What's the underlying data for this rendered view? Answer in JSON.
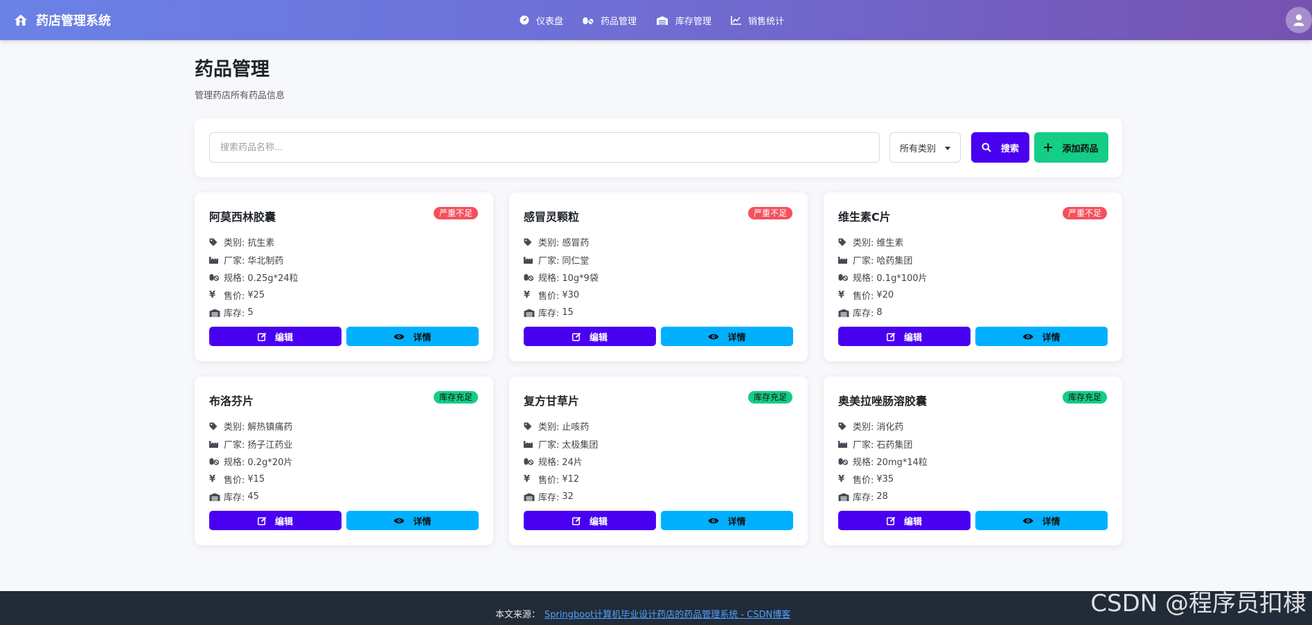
{
  "navbar": {
    "brand": "药店管理系统",
    "items": [
      {
        "label": "仪表盘",
        "icon": "dashboard-icon"
      },
      {
        "label": "药品管理",
        "icon": "pills-icon"
      },
      {
        "label": "库存管理",
        "icon": "warehouse-icon"
      },
      {
        "label": "销售统计",
        "icon": "chart-line-icon"
      }
    ]
  },
  "page": {
    "title": "药品管理",
    "subtitle": "管理药店所有药品信息"
  },
  "search": {
    "placeholder": "搜索药品名称...",
    "category_selected": "所有类别",
    "search_label": "搜索",
    "add_label": "添加药品"
  },
  "labels": {
    "category": "类别:",
    "maker": "厂家:",
    "spec": "规格:",
    "price": "售价:",
    "stock": "库存:",
    "edit": "编辑",
    "detail": "详情"
  },
  "medicines": [
    {
      "name": "阿莫西林胶囊",
      "status": "严重不足",
      "status_type": "low",
      "category": "抗生素",
      "maker": "华北制药",
      "spec": "0.25g*24粒",
      "price": "¥25",
      "stock": "5"
    },
    {
      "name": "感冒灵颗粒",
      "status": "严重不足",
      "status_type": "low",
      "category": "感冒药",
      "maker": "同仁堂",
      "spec": "10g*9袋",
      "price": "¥30",
      "stock": "15"
    },
    {
      "name": "维生素C片",
      "status": "严重不足",
      "status_type": "low",
      "category": "维生素",
      "maker": "哈药集团",
      "spec": "0.1g*100片",
      "price": "¥20",
      "stock": "8"
    },
    {
      "name": "布洛芬片",
      "status": "库存充足",
      "status_type": "ok",
      "category": "解热镇痛药",
      "maker": "扬子江药业",
      "spec": "0.2g*20片",
      "price": "¥15",
      "stock": "45"
    },
    {
      "name": "复方甘草片",
      "status": "库存充足",
      "status_type": "ok",
      "category": "止咳药",
      "maker": "太极集团",
      "spec": "24片",
      "price": "¥12",
      "stock": "32"
    },
    {
      "name": "奥美拉唑肠溶胶囊",
      "status": "库存充足",
      "status_type": "ok",
      "category": "消化药",
      "maker": "石药集团",
      "spec": "20mg*14粒",
      "price": "¥35",
      "stock": "28"
    }
  ],
  "footer": {
    "prefix": "本文来源：",
    "link_text": "Springboot计算机毕业设计药店的药品管理系统 - CSDN博客"
  },
  "watermark": "CSDN @程序员扣棣"
}
